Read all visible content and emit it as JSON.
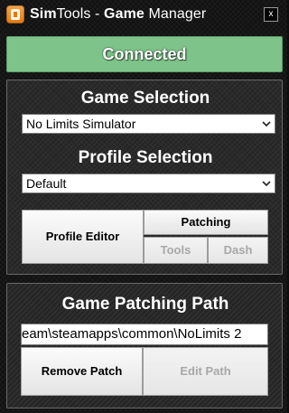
{
  "window": {
    "title_prefix": "Sim",
    "title_mid": "Tools - ",
    "title_bold": "Game",
    "title_suffix": " Manager",
    "close_label": "x",
    "app_icon": "simtools-app-icon"
  },
  "status": {
    "text": "Connected",
    "color": "#7ec48a"
  },
  "game_selection": {
    "heading": "Game Selection",
    "selected": "No Limits Simulator"
  },
  "profile_selection": {
    "heading": "Profile Selection",
    "selected": "Default"
  },
  "buttons": {
    "profile_editor": "Profile Editor",
    "patching": "Patching",
    "tools": "Tools",
    "dash": "Dash"
  },
  "patching_path": {
    "heading": "Game Patching Path",
    "value": "eam\\steamapps\\common\\NoLimits 2",
    "remove_patch": "Remove Patch",
    "edit_path": "Edit Path"
  }
}
